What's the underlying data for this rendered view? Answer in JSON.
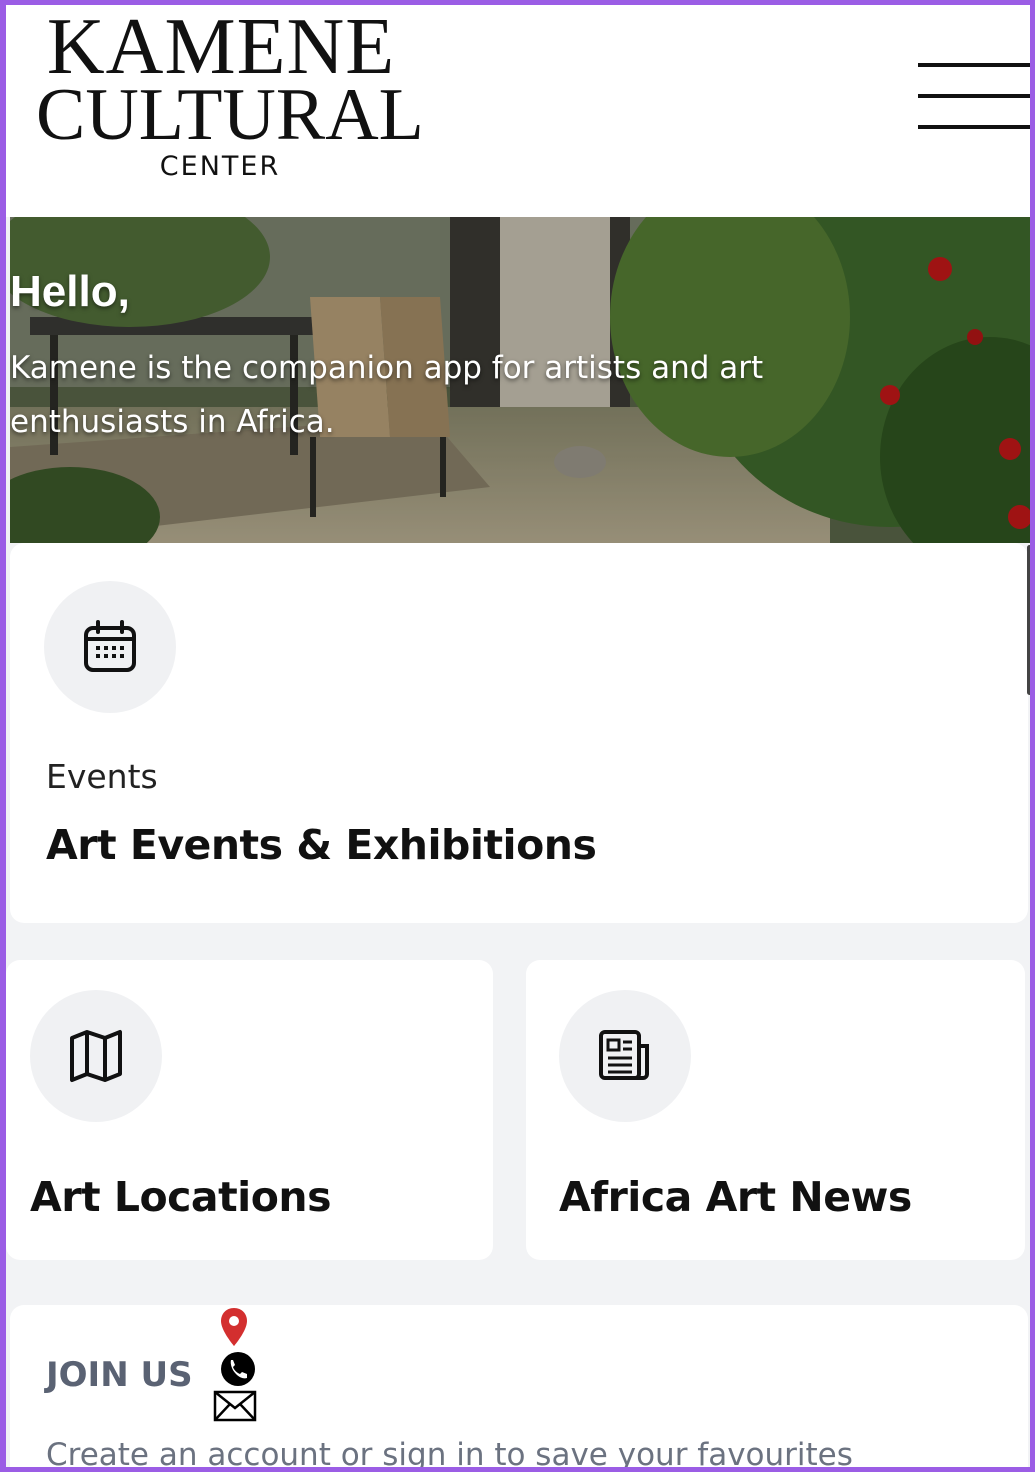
{
  "header": {
    "logo_line1": "KAMENE",
    "logo_line2": "CULTURAL",
    "logo_line3": "CENTER",
    "menu_icon": "hamburger-icon"
  },
  "hero": {
    "greeting": "Hello,",
    "subtitle": "Kamene is the companion app for artists and art enthusiasts in Africa."
  },
  "cards": {
    "events": {
      "label": "Events",
      "title": "Art Events & Exhibitions",
      "icon": "calendar-icon"
    },
    "locations": {
      "title": "Art Locations",
      "icon": "map-icon"
    },
    "news": {
      "title": "Africa Art News",
      "icon": "newspaper-icon"
    }
  },
  "join": {
    "title": "JOIN US",
    "subtitle": "Create an account or sign in to save your favourites",
    "contact_icons": [
      "location-pin-icon",
      "phone-icon",
      "mail-icon"
    ]
  },
  "colors": {
    "frame_border": "#9b5de5",
    "page_bg": "#f2f3f5",
    "icon_circle_bg": "#f0f1f3",
    "pin_red": "#d32f2f"
  }
}
